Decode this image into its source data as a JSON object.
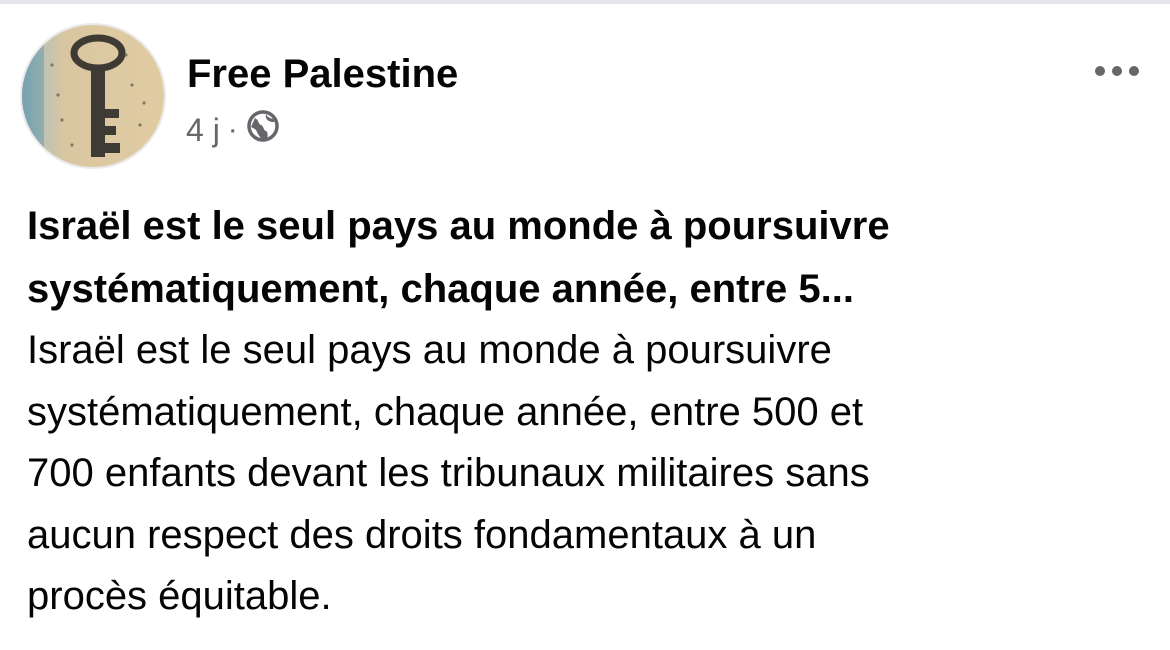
{
  "post": {
    "author": "Free Palestine",
    "time": "4 j",
    "separator": "·",
    "privacy_icon": "globe-icon",
    "menu_icon": "more-options-icon",
    "headline_lines": [
      "Israël est le seul pays au monde à poursuivre",
      "systématiquement, chaque année, entre 5..."
    ],
    "body_lines": [
      "Israël est le seul pays au monde à poursuivre",
      "systématiquement, chaque année, entre 500 et",
      "700 enfants devant les tribunaux militaires sans",
      "aucun respect des droits fondamentaux à un",
      "procès équitable."
    ]
  },
  "colors": {
    "text": "#050505",
    "secondary": "#65676b",
    "divider": "#e4e6eb"
  }
}
